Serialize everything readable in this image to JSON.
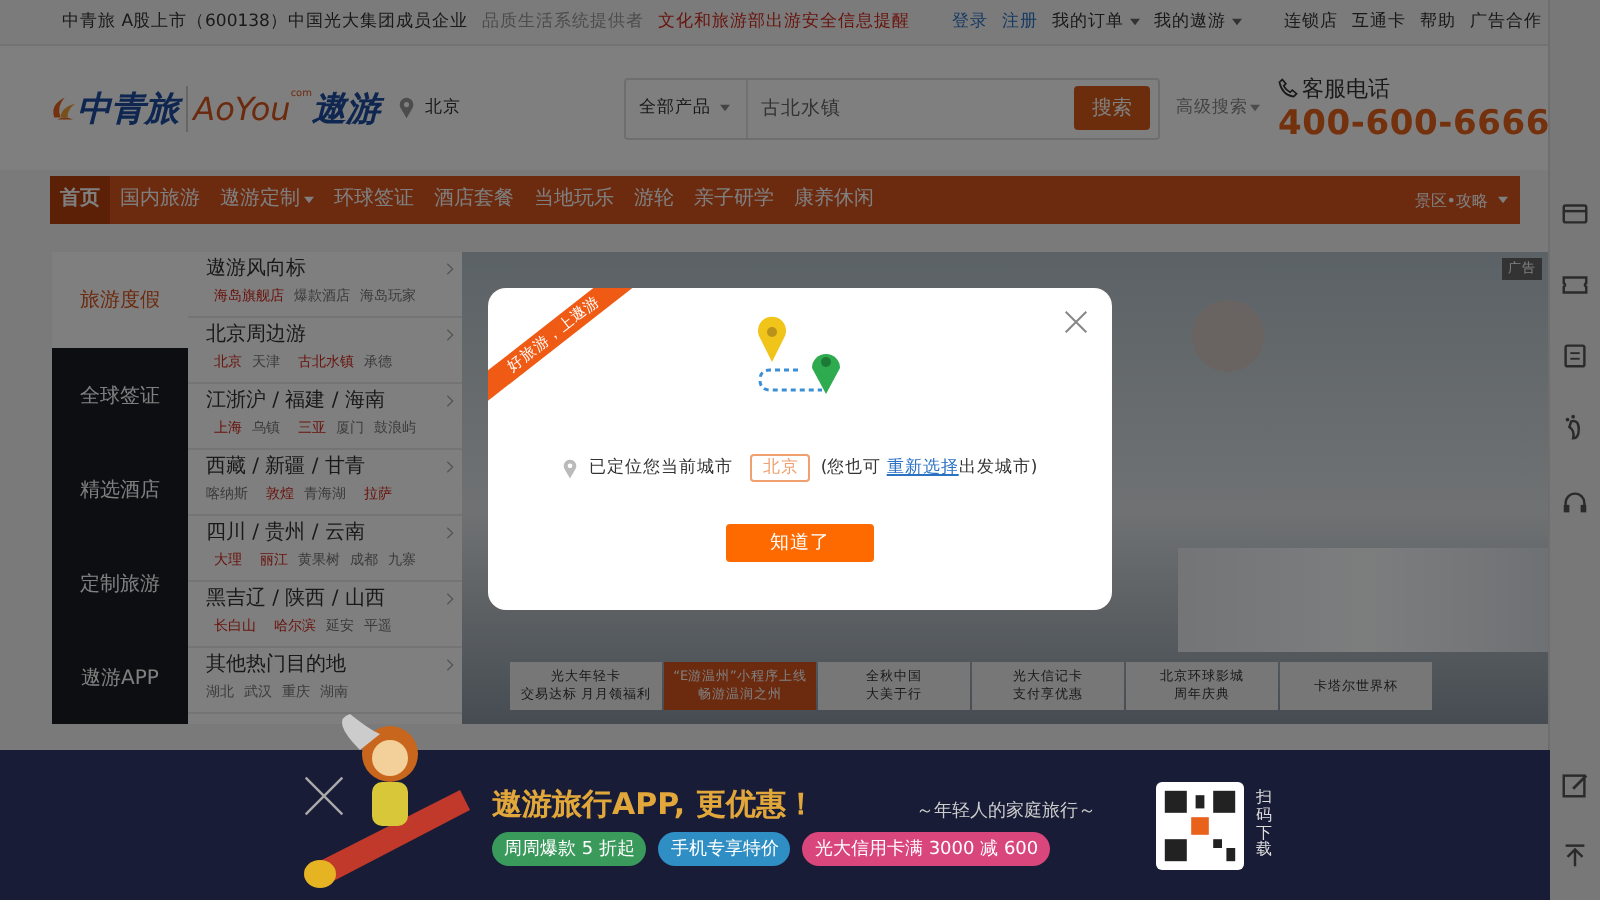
{
  "top_bar": {
    "notice": "中青旅 A股上市（600138）中国光大集团成员企业",
    "slogan": "品质生活系统提供者",
    "alert": "文化和旅游部出游安全信息提醒",
    "login": "登录",
    "register": "注册",
    "menus": [
      "我的订单",
      "我的遨游"
    ],
    "links": [
      "连锁店",
      "互通卡",
      "帮助",
      "广告合作"
    ]
  },
  "header": {
    "logo_cn": "中青旅",
    "logo_en": "AoYou",
    "logo_com": "com",
    "logo_cn2": "遨游",
    "city": "北京",
    "search": {
      "category": "全部产品",
      "value": "古北水镇",
      "button": "搜索"
    },
    "advanced": "高级搜索",
    "hotline_label": "客服电话",
    "hotline": "400-600-6666"
  },
  "nav": {
    "items": [
      {
        "label": "首页",
        "selected": true,
        "caret": false
      },
      {
        "label": "国内旅游",
        "selected": false,
        "caret": false
      },
      {
        "label": "遨游定制",
        "selected": false,
        "caret": true
      },
      {
        "label": "环球签证",
        "selected": false,
        "caret": false
      },
      {
        "label": "酒店套餐",
        "selected": false,
        "caret": false
      },
      {
        "label": "当地玩乐",
        "selected": false,
        "caret": false
      },
      {
        "label": "游轮",
        "selected": false,
        "caret": false
      },
      {
        "label": "亲子研学",
        "selected": false,
        "caret": false
      },
      {
        "label": "康养休闲",
        "selected": false,
        "caret": false
      }
    ],
    "right": "景区•攻略"
  },
  "side_menu": {
    "categories": [
      {
        "label": "旅游度假",
        "selected": true
      },
      {
        "label": "全球签证",
        "selected": false
      },
      {
        "label": "精选酒店",
        "selected": false
      },
      {
        "label": "定制旅游",
        "selected": false
      },
      {
        "label": "遨游APP",
        "selected": false
      }
    ],
    "destinations": [
      {
        "title": "遨游风向标",
        "tags": [
          {
            "text": "海岛旗舰店",
            "hot": true
          },
          {
            "text": "爆款酒店",
            "hot": false
          },
          {
            "text": "海岛玩家",
            "hot": false
          }
        ]
      },
      {
        "title": "北京周边游",
        "tags": [
          {
            "text": "北京",
            "hot": true
          },
          {
            "text": "天津",
            "hot": false
          },
          {
            "text": "古北水镇",
            "hot": true
          },
          {
            "text": "承德",
            "hot": false
          }
        ]
      },
      {
        "title": "江浙沪 / 福建 / 海南",
        "tags": [
          {
            "text": "上海",
            "hot": true
          },
          {
            "text": "乌镇",
            "hot": false
          },
          {
            "text": "三亚",
            "hot": true
          },
          {
            "text": "厦门",
            "hot": false
          },
          {
            "text": "鼓浪屿",
            "hot": false
          }
        ]
      },
      {
        "title": "西藏 / 新疆 / 甘青",
        "tags": [
          {
            "text": "喀纳斯",
            "hot": false
          },
          {
            "text": "敦煌",
            "hot": true
          },
          {
            "text": "青海湖",
            "hot": false
          },
          {
            "text": "拉萨",
            "hot": true
          }
        ]
      },
      {
        "title": "四川 / 贵州 / 云南",
        "tags": [
          {
            "text": "大理",
            "hot": true
          },
          {
            "text": "丽江",
            "hot": true
          },
          {
            "text": "黄果树",
            "hot": false
          },
          {
            "text": "成都",
            "hot": false
          },
          {
            "text": "九寨",
            "hot": false
          }
        ]
      },
      {
        "title": "黑吉辽 / 陕西 / 山西",
        "tags": [
          {
            "text": "长白山",
            "hot": true
          },
          {
            "text": "哈尔滨",
            "hot": true
          },
          {
            "text": "延安",
            "hot": false
          },
          {
            "text": "平遥",
            "hot": false
          }
        ]
      },
      {
        "title": "其他热门目的地",
        "tags": [
          {
            "text": "湖北",
            "hot": false
          },
          {
            "text": "武汉",
            "hot": false
          },
          {
            "text": "重庆",
            "hot": false
          },
          {
            "text": "湖南",
            "hot": false
          }
        ]
      }
    ]
  },
  "banner": {
    "ad": "广告",
    "promo_tabs": [
      {
        "lines": [
          "光大年轻卡",
          "交易达标 月月领福利"
        ],
        "selected": false
      },
      {
        "lines": [
          "“E游温州”小程序上线",
          "畅游温润之州"
        ],
        "selected": true
      },
      {
        "lines": [
          "全秋中国",
          "大美于行"
        ],
        "selected": false
      },
      {
        "lines": [
          "光大信记卡",
          "支付享优惠"
        ],
        "selected": false
      },
      {
        "lines": [
          "北京环球影城",
          "周年庆典"
        ],
        "selected": false
      },
      {
        "lines": [
          "卡塔尔世界杯"
        ],
        "selected": false
      }
    ]
  },
  "modal": {
    "ribbon": "好旅游，上遨游",
    "message": "已定位您当前城市",
    "city": "北京",
    "hint_before": "(您也可 ",
    "hint_link": "重新选择",
    "hint_after": "出发城市)",
    "button": "知道了"
  },
  "app_banner": {
    "title": "遨游旅行APP, 更优惠！",
    "subtitle": "～年轻人的家庭旅行～",
    "tags": [
      {
        "text": "周周爆款 5 折起",
        "color": "#3a9a5c"
      },
      {
        "text": "手机专享特价",
        "color": "#2f8ec4"
      },
      {
        "text": "光大信用卡满 3000 减 600",
        "color": "#d9467c"
      }
    ],
    "qr_label": "扫码下载"
  }
}
